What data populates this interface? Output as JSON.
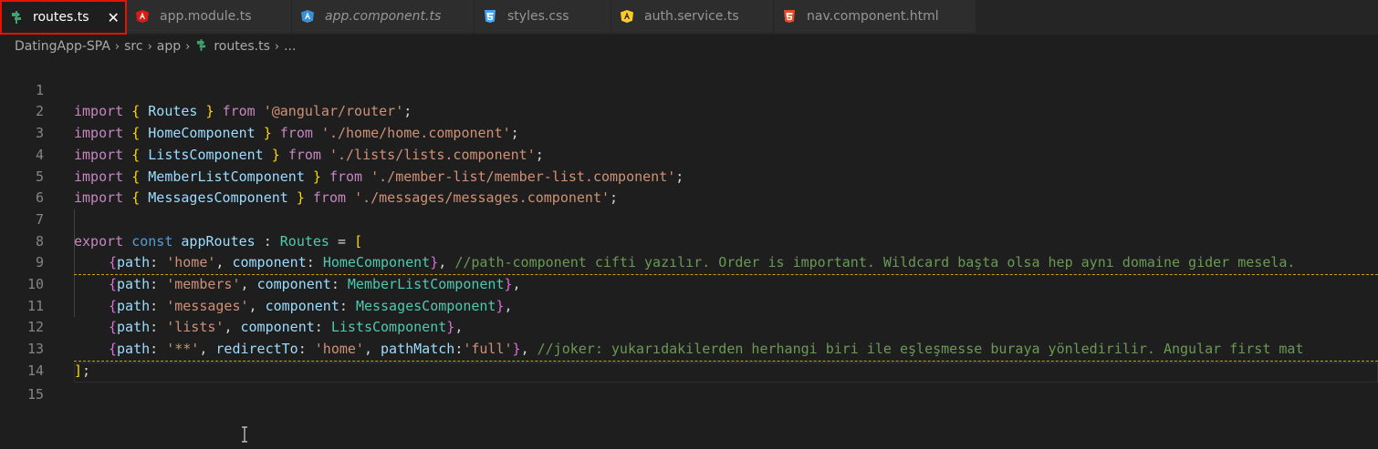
{
  "tabs": [
    {
      "name": "routes.ts",
      "icon": "route-icon",
      "color": "#3ca370",
      "active": true
    },
    {
      "name": "app.module.ts",
      "icon": "angular-red-icon",
      "color": "#dd1b16"
    },
    {
      "name": "app.component.ts",
      "icon": "angular-blue-icon",
      "color": "#3b8fd6",
      "italic": true
    },
    {
      "name": "styles.css",
      "icon": "css-icon",
      "color": "#42a5f5"
    },
    {
      "name": "auth.service.ts",
      "icon": "angular-yellow-icon",
      "color": "#ffca28"
    },
    {
      "name": "nav.component.html",
      "icon": "html5-icon",
      "color": "#e44d26"
    }
  ],
  "breadcrumb": {
    "items": [
      "DatingApp-SPA",
      "src",
      "app",
      "routes.ts",
      "..."
    ]
  },
  "editor": {
    "lines": [
      {
        "n": "1"
      },
      {
        "n": "2"
      },
      {
        "n": "3"
      },
      {
        "n": "4"
      },
      {
        "n": "5"
      },
      {
        "n": "6"
      },
      {
        "n": "7"
      },
      {
        "n": "8"
      },
      {
        "n": "9"
      },
      {
        "n": "10"
      },
      {
        "n": "11"
      },
      {
        "n": "12"
      },
      {
        "n": "13"
      },
      {
        "n": "14"
      },
      {
        "n": "15"
      }
    ],
    "code": {
      "l1": [
        "import",
        " { ",
        "Routes",
        " } ",
        "from",
        " ",
        "'@angular/router'",
        ";"
      ],
      "l2": [
        "import",
        " { ",
        "HomeComponent",
        " } ",
        "from",
        " ",
        "'./home/home.component'",
        ";"
      ],
      "l3": [
        "import",
        " { ",
        "ListsComponent",
        " } ",
        "from",
        " ",
        "'./lists/lists.component'",
        ";"
      ],
      "l4": [
        "import",
        " { ",
        "MemberListComponent",
        " } ",
        "from",
        " ",
        "'./member-list/member-list.component'",
        ";"
      ],
      "l5": [
        "import",
        " { ",
        "MessagesComponent",
        " } ",
        "from",
        " ",
        "'./messages/messages.component'",
        ";"
      ],
      "l7": [
        "export",
        " ",
        "const",
        " ",
        "appRoutes",
        " : ",
        "Routes",
        " = ",
        "["
      ],
      "l8": [
        "{",
        "path",
        ": ",
        "'home'",
        ", ",
        "component",
        ": ",
        "HomeComponent",
        "}",
        ", ",
        "//path-component cifti yazılır. Order is important. Wildcard başta olsa hep aynı domaine gider mesela."
      ],
      "l9": [
        "{",
        "path",
        ": ",
        "'members'",
        ", ",
        "component",
        ": ",
        "MemberListComponent",
        "}",
        ","
      ],
      "l10": [
        "{",
        "path",
        ": ",
        "'messages'",
        ", ",
        "component",
        ": ",
        "MessagesComponent",
        "}",
        ","
      ],
      "l11": [
        "{",
        "path",
        ": ",
        "'lists'",
        ", ",
        "component",
        ": ",
        "ListsComponent",
        "}",
        ","
      ],
      "l12": [
        "{",
        "path",
        ": ",
        "'**'",
        ", ",
        "redirectTo",
        ": ",
        "'home'",
        ", ",
        "pathMatch",
        ":",
        "'full'",
        "}",
        ", ",
        "//joker: yukarıdakilerden herhangi biri ile eşleşmesse buraya yönledirilir. Angular first mat"
      ],
      "l13": [
        "]",
        ";"
      ]
    }
  }
}
